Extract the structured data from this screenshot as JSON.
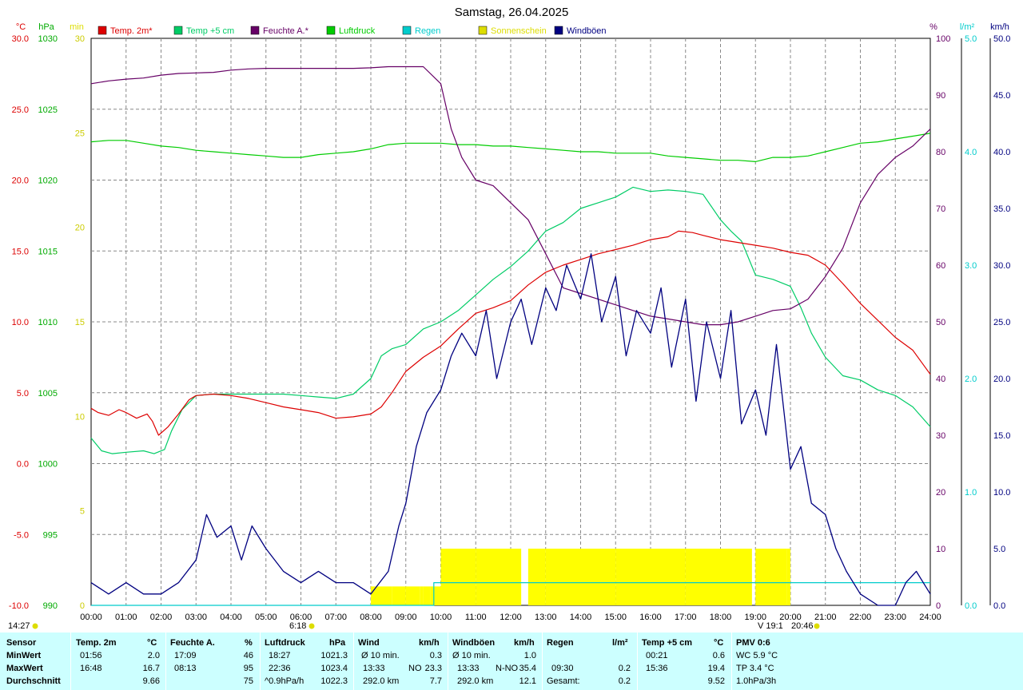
{
  "title": "Samstag, 26.04.2025",
  "legend": [
    {
      "label": "Temp. 2m*",
      "color": "#dd0000"
    },
    {
      "label": "Temp +5 cm",
      "color": "#00cc66"
    },
    {
      "label": "Feuchte A.*",
      "color": "#660066"
    },
    {
      "label": "Luftdruck",
      "color": "#00cc00"
    },
    {
      "label": "Regen",
      "color": "#00cccc"
    },
    {
      "label": "Sonnenschein",
      "color": "#dddd00"
    },
    {
      "label": "Windböen",
      "color": "#000080"
    }
  ],
  "axis_headers": {
    "temp": "°C",
    "pressure": "hPa",
    "sun": "min",
    "humidity": "%",
    "rain": "l/m²",
    "wind": "km/h"
  },
  "time_ticks": [
    "00:00",
    "01:00",
    "02:00",
    "03:00",
    "04:00",
    "05:00",
    "06:00",
    "07:00",
    "08:00",
    "09:00",
    "10:00",
    "11:00",
    "12:00",
    "13:00",
    "14:00",
    "15:00",
    "16:00",
    "17:00",
    "18:00",
    "19:00",
    "20:00",
    "21:00",
    "22:00",
    "23:00",
    "24:00"
  ],
  "footer_labels": {
    "moonrise": "14:27",
    "sunrise": "6:18",
    "sunset": "V 19:1",
    "moonset": "20:46"
  },
  "chart_data": {
    "type": "line",
    "x_range": [
      0,
      24
    ],
    "axes": {
      "temp": {
        "min": -10,
        "max": 30,
        "ticks": [
          "30.0",
          "25.0",
          "20.0",
          "15.0",
          "10.0",
          "5.0",
          "0.0",
          "-5.0",
          "-10.0"
        ],
        "color": "#dd0000"
      },
      "pressure": {
        "min": 990,
        "max": 1030,
        "ticks": [
          "1030",
          "1025",
          "1020",
          "1015",
          "1010",
          "1005",
          "1000",
          "995",
          "990"
        ],
        "color": "#00aa00"
      },
      "sun": {
        "min": 0,
        "max": 30,
        "ticks": [
          "30",
          "25",
          "20",
          "15",
          "10",
          "5",
          "0"
        ],
        "color": "#dddd00"
      },
      "humidity": {
        "min": 0,
        "max": 100,
        "ticks": [
          "100",
          "90",
          "80",
          "70",
          "60",
          "50",
          "40",
          "30",
          "20",
          "10",
          "0"
        ],
        "color": "#660066"
      },
      "rain": {
        "min": 0,
        "max": 5,
        "ticks": [
          "5.0",
          "4.0",
          "3.0",
          "2.0",
          "1.0",
          "0.0"
        ],
        "color": "#00cccc"
      },
      "wind": {
        "min": 0,
        "max": 50,
        "ticks": [
          "50.0",
          "45.0",
          "40.0",
          "35.0",
          "30.0",
          "25.0",
          "20.0",
          "15.0",
          "10.0",
          "5.0",
          "0.0"
        ],
        "color": "#000080"
      }
    },
    "series": [
      {
        "name": "Temp. 2m*",
        "axis": "temp",
        "x": [
          0,
          0.2,
          0.5,
          0.8,
          1.0,
          1.3,
          1.6,
          1.75,
          1.93,
          2.2,
          2.5,
          2.8,
          3.0,
          3.5,
          4.0,
          4.5,
          5.0,
          5.5,
          6.0,
          6.5,
          7.0,
          7.5,
          8.0,
          8.3,
          8.6,
          9.0,
          9.5,
          10.0,
          10.5,
          11.0,
          11.5,
          12.0,
          12.5,
          13.0,
          13.5,
          14.0,
          14.5,
          15.0,
          15.5,
          16.0,
          16.5,
          16.8,
          17.2,
          17.5,
          18.0,
          18.5,
          19.0,
          19.5,
          20.0,
          20.5,
          21.0,
          21.5,
          22.0,
          22.5,
          23.0,
          23.5,
          24.0
        ],
        "y": [
          3.9,
          3.6,
          3.4,
          3.8,
          3.6,
          3.2,
          3.5,
          3.0,
          2.0,
          2.6,
          3.5,
          4.5,
          4.8,
          4.9,
          4.8,
          4.6,
          4.3,
          4.0,
          3.8,
          3.6,
          3.2,
          3.3,
          3.5,
          4.0,
          5.0,
          6.5,
          7.5,
          8.3,
          9.5,
          10.6,
          11.0,
          11.5,
          12.6,
          13.5,
          14.0,
          14.4,
          14.8,
          15.1,
          15.4,
          15.8,
          16.0,
          16.4,
          16.3,
          16.1,
          15.8,
          15.6,
          15.4,
          15.2,
          14.9,
          14.7,
          14.0,
          12.7,
          11.3,
          10.1,
          8.9,
          8.0,
          6.3
        ]
      },
      {
        "name": "Temp +5 cm",
        "axis": "temp",
        "x": [
          0,
          0.3,
          0.6,
          1.0,
          1.5,
          1.8,
          2.1,
          2.3,
          2.6,
          3.0,
          3.5,
          4.0,
          4.5,
          5.0,
          5.5,
          6.0,
          6.5,
          7.0,
          7.5,
          8.0,
          8.3,
          8.6,
          9.0,
          9.5,
          10.0,
          10.5,
          11.0,
          11.5,
          12.0,
          12.5,
          13.0,
          13.5,
          14.0,
          14.5,
          15.0,
          15.5,
          16.0,
          16.5,
          17.0,
          17.5,
          18.0,
          18.3,
          18.6,
          19.0,
          19.5,
          20.0,
          20.3,
          20.6,
          21.0,
          21.5,
          22.0,
          22.5,
          23.0,
          23.5,
          24.0
        ],
        "y": [
          1.8,
          0.9,
          0.7,
          0.8,
          0.9,
          0.7,
          1.0,
          2.3,
          3.8,
          4.8,
          4.9,
          4.9,
          4.9,
          4.9,
          4.9,
          4.8,
          4.7,
          4.6,
          4.9,
          6.0,
          7.6,
          8.1,
          8.4,
          9.5,
          10.0,
          10.8,
          11.9,
          13.0,
          13.9,
          15.0,
          16.4,
          17.0,
          18.0,
          18.4,
          18.8,
          19.5,
          19.2,
          19.3,
          19.2,
          19.0,
          17.2,
          16.4,
          15.7,
          13.3,
          13.0,
          12.5,
          11.0,
          9.2,
          7.5,
          6.2,
          5.9,
          5.2,
          4.8,
          4.0,
          2.6
        ]
      },
      {
        "name": "Feuchte A.*",
        "axis": "humidity",
        "x": [
          0,
          0.5,
          1.0,
          1.5,
          2.0,
          2.5,
          3.0,
          3.5,
          4.0,
          4.5,
          5.0,
          5.5,
          6.0,
          6.5,
          7.0,
          7.5,
          8.0,
          8.5,
          9.0,
          9.5,
          10.0,
          10.3,
          10.6,
          11.0,
          11.5,
          12.0,
          12.5,
          13.0,
          13.5,
          14.0,
          14.5,
          15.0,
          15.5,
          16.0,
          16.5,
          17.0,
          17.5,
          18.0,
          18.5,
          19.0,
          19.5,
          20.0,
          20.5,
          21.0,
          21.5,
          22.0,
          22.5,
          23.0,
          23.5,
          24.0
        ],
        "y": [
          92,
          92.5,
          92.8,
          93,
          93.5,
          93.8,
          93.9,
          94,
          94.4,
          94.6,
          94.7,
          94.7,
          94.7,
          94.7,
          94.7,
          94.7,
          94.8,
          95,
          95,
          95,
          92,
          84,
          79,
          75,
          74,
          71,
          68,
          62,
          56,
          55,
          54,
          53,
          52,
          51,
          50.5,
          50,
          49.5,
          49.5,
          50,
          51,
          52,
          52.3,
          54,
          58,
          63,
          71,
          76,
          79,
          81,
          84
        ]
      },
      {
        "name": "Luftdruck",
        "axis": "pressure",
        "x": [
          0,
          0.5,
          1.0,
          1.5,
          2.0,
          2.5,
          3.0,
          3.5,
          4.0,
          4.5,
          5.0,
          5.5,
          6.0,
          6.5,
          7.0,
          7.5,
          8.0,
          8.5,
          9.0,
          9.5,
          10.0,
          10.5,
          11.0,
          11.5,
          12.0,
          12.5,
          13.0,
          13.5,
          14.0,
          14.5,
          15.0,
          15.5,
          16.0,
          16.5,
          17.0,
          17.5,
          18.0,
          18.5,
          19.0,
          19.5,
          20.0,
          20.5,
          21.0,
          21.5,
          22.0,
          22.5,
          23.0,
          23.5,
          24.0
        ],
        "y": [
          1022.7,
          1022.8,
          1022.8,
          1022.6,
          1022.4,
          1022.3,
          1022.1,
          1022.0,
          1021.9,
          1021.8,
          1021.7,
          1021.6,
          1021.6,
          1021.8,
          1021.9,
          1022.0,
          1022.2,
          1022.5,
          1022.6,
          1022.6,
          1022.6,
          1022.5,
          1022.5,
          1022.4,
          1022.4,
          1022.3,
          1022.2,
          1022.1,
          1022.0,
          1022.0,
          1021.9,
          1021.9,
          1021.9,
          1021.7,
          1021.6,
          1021.5,
          1021.4,
          1021.4,
          1021.3,
          1021.6,
          1021.6,
          1021.7,
          1022.0,
          1022.3,
          1022.6,
          1022.7,
          1022.9,
          1023.1,
          1023.3
        ]
      },
      {
        "name": "Regen",
        "axis": "rain",
        "x": [
          0,
          9.8,
          9.8,
          20.0,
          20.0,
          24.0
        ],
        "y": [
          0,
          0,
          0.2,
          0.2,
          0.2,
          0.2
        ]
      },
      {
        "name": "Windböen",
        "axis": "wind",
        "x": [
          0,
          0.5,
          1.0,
          1.5,
          2.0,
          2.5,
          3.0,
          3.3,
          3.6,
          4.0,
          4.3,
          4.6,
          5.0,
          5.5,
          6.0,
          6.5,
          7.0,
          7.5,
          8.0,
          8.5,
          8.8,
          9.0,
          9.3,
          9.6,
          10.0,
          10.3,
          10.6,
          11.0,
          11.3,
          11.6,
          12.0,
          12.3,
          12.6,
          13.0,
          13.3,
          13.6,
          14.0,
          14.3,
          14.6,
          15.0,
          15.3,
          15.6,
          16.0,
          16.3,
          16.6,
          17.0,
          17.3,
          17.6,
          18.0,
          18.3,
          18.6,
          19.0,
          19.3,
          19.6,
          20.0,
          20.3,
          20.6,
          21.0,
          21.3,
          21.6,
          22.0,
          22.5,
          23.0,
          23.3,
          23.6,
          24.0
        ],
        "y": [
          2,
          1,
          2,
          1,
          1,
          2,
          4,
          8,
          6,
          7,
          4,
          7,
          5,
          3,
          2,
          3,
          2,
          2,
          1,
          3,
          7,
          9,
          14,
          17,
          19,
          22,
          24,
          22,
          26,
          20,
          25,
          27,
          23,
          28,
          26,
          30,
          27,
          31,
          25,
          29,
          22,
          26,
          24,
          28,
          21,
          27,
          18,
          25,
          20,
          26,
          16,
          19,
          15,
          23,
          12,
          14,
          9,
          8,
          5,
          3,
          1,
          0,
          0,
          2,
          3,
          1
        ]
      },
      {
        "name": "Sonnenschein",
        "axis": "sun",
        "x": [
          0,
          7.95,
          8.0,
          8.6,
          9.0,
          9.4,
          9.5,
          9.7,
          10.0,
          11.0,
          12.0,
          12.3,
          12.5,
          13.0,
          14.0,
          15.0,
          16.0,
          17.0,
          18.0,
          18.9,
          19.0,
          19.9,
          20.0,
          24.0
        ],
        "y": [
          0,
          0,
          1,
          1,
          1,
          1,
          1,
          1,
          3,
          3,
          3,
          0,
          3,
          3,
          3,
          3,
          3,
          3,
          3,
          0,
          3,
          3,
          0,
          0
        ]
      }
    ]
  },
  "stats": {
    "headers": {
      "sensor": "Sensor",
      "temp": "Temp. 2m",
      "temp_unit": "°C",
      "hum": "Feuchte A.",
      "hum_unit": "%",
      "press": "Luftdruck",
      "press_unit": "hPa",
      "wind": "Wind",
      "wind_unit": "km/h",
      "gust": "Windböen",
      "gust_unit": "km/h",
      "rain": "Regen",
      "rain_unit": "l/m²",
      "temp5": "Temp +5 cm",
      "temp5_unit": "°C",
      "pmv": "PMV 0:6"
    },
    "row_labels": [
      "MinWert",
      "MaxWert",
      "Durchschnitt"
    ],
    "temp": [
      [
        "01:56",
        "2.0"
      ],
      [
        "16:48",
        "16.7"
      ],
      [
        "",
        "9.66"
      ]
    ],
    "hum": [
      [
        "17:09",
        "46"
      ],
      [
        "08:13",
        "95"
      ],
      [
        "",
        "75"
      ]
    ],
    "press": [
      [
        "18:27",
        "1021.3"
      ],
      [
        "22:36",
        "1023.4"
      ],
      [
        "^0.9hPa/h",
        "1022.3"
      ]
    ],
    "wind": [
      [
        "Ø 10 min.",
        "",
        "0.3"
      ],
      [
        "13:33",
        "NO",
        "23.3"
      ],
      [
        "292.0 km",
        "",
        "7.7"
      ]
    ],
    "gust": [
      [
        "Ø 10 min.",
        "",
        "1.0"
      ],
      [
        "13:33",
        "N-NO",
        "35.4"
      ],
      [
        "292.0 km",
        "",
        "12.1"
      ]
    ],
    "rain": [
      [
        "",
        ""
      ],
      [
        "09:30",
        "0.2"
      ],
      [
        "Gesamt:",
        "0.2"
      ]
    ],
    "temp5": [
      [
        "00:21",
        "0.6"
      ],
      [
        "15:36",
        "19.4"
      ],
      [
        "",
        "9.52"
      ]
    ],
    "pmv": [
      "WC 5.9 °C",
      "TP 3.4 °C",
      "1.0hPa/3h"
    ]
  }
}
